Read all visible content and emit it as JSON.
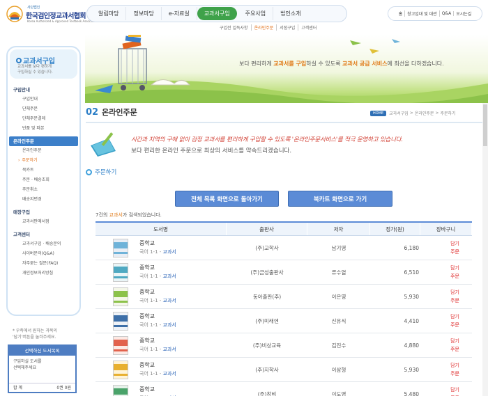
{
  "header": {
    "logo": {
      "small": "사단법인",
      "title": "한국검인정교과서협회",
      "eng": "Korea Authorized & Approved Textbook Association"
    },
    "gnb": [
      "알림마당",
      "정보마당",
      "e-자료실",
      "교과서구입",
      "주요사업",
      "법인소개"
    ],
    "gnb_active_index": 3,
    "subnav": [
      "구입전 일독사항",
      "온라인주문",
      "서점구입",
      "고객센터"
    ],
    "subnav_active_index": 1,
    "util": [
      "홈",
      "창고임대 및 대관",
      "Q&A",
      "오시는길"
    ]
  },
  "visual": {
    "text_pre": "보다 편리하게 ",
    "text_hl1": "교과서를 구입",
    "text_mid": "하실 수 있도록 ",
    "text_hl2": "교과서 공급 서비스",
    "text_post": "에 최선을 다하겠습니다."
  },
  "sidebar": {
    "title": "교과서구입",
    "desc1": "교과서를 보다 편하게",
    "desc2": "구입하실 수 있습니다.",
    "menu": [
      {
        "label": "구입안내",
        "level": 1,
        "active": false
      },
      {
        "label": "구입안내",
        "level": 2,
        "active": false
      },
      {
        "label": "단체주문",
        "level": 2,
        "active": false
      },
      {
        "label": "단체주문결제",
        "level": 2,
        "active": false
      },
      {
        "label": "반품 및 파본",
        "level": 2,
        "active": false
      },
      {
        "label": "온라인주문",
        "level": 1,
        "active": true
      },
      {
        "label": "온라인주문",
        "level": 2,
        "active": false
      },
      {
        "label": "주문하기",
        "level": 2,
        "active": true
      },
      {
        "label": "북카트",
        "level": 2,
        "active": false
      },
      {
        "label": "주문 · 배송조회",
        "level": 2,
        "active": false
      },
      {
        "label": "주문취소",
        "level": 2,
        "active": false
      },
      {
        "label": "배송지변경",
        "level": 2,
        "active": false
      },
      {
        "label": "매장구입",
        "level": 1,
        "active": false
      },
      {
        "label": "교과서판매서점",
        "level": 2,
        "active": false
      },
      {
        "label": "고객센터",
        "level": 1,
        "active": false
      },
      {
        "label": "교과서구입 · 배송문의",
        "level": 2,
        "active": false
      },
      {
        "label": "사이버문의(Q&A)",
        "level": 2,
        "active": false
      },
      {
        "label": "자주묻는 질문(FAQ)",
        "level": 2,
        "active": false
      },
      {
        "label": "개인정보처리방침",
        "level": 2,
        "active": false
      }
    ],
    "note1": "* 우측에서 원하는 과목의",
    "note2": "'담기'버튼을 눌러주세요.",
    "box": {
      "title": "선택하신 도서목록",
      "line1": "구입하실 도서를",
      "line2": "선택해주세요",
      "total_label": "합 계",
      "total_value": "0권 0원"
    }
  },
  "page": {
    "num": "02",
    "title": "온라인주문",
    "breadcrumb_home": "HOME",
    "breadcrumb": [
      "교과서구입",
      "온라인주문",
      "주문하기"
    ],
    "intro1": "시간과 지역의 구애 없이 검정 교과서를 편리하게 구입할 수 있도록 '온라인주문서비스'를 적극 운영하고 있습니다.",
    "intro2": "보다 편리한 온라인 주문으로 최상의 서비스를 약속드리겠습니다.",
    "section": "주문하기",
    "btn_back": "전체 목록 화면으로 돌아가기",
    "btn_cart": "북카트 화면으로 가기",
    "count_num": "7",
    "count_pre": "건의 ",
    "count_hl": "교과서",
    "count_post": "가 검색되었습니다.",
    "columns": [
      "도서명",
      "출판사",
      "저자",
      "정가(원)",
      "장바구니"
    ],
    "rows": [
      {
        "level": "중학교",
        "subject": "국어 1-1",
        "type": "교과서",
        "publisher": "(주)교학사",
        "author": "남기영",
        "price": "6,180",
        "act1": "담기",
        "act2": "주문",
        "cover": "#e9eef5",
        "band": "#6fb3d9"
      },
      {
        "level": "중학교",
        "subject": "국어 1-1",
        "type": "교과서",
        "publisher": "(주)금성출판사",
        "author": "류수열",
        "price": "6,510",
        "act1": "담기",
        "act2": "주문",
        "cover": "#eaf5f7",
        "band": "#4fa9c2"
      },
      {
        "level": "중학교",
        "subject": "국어 1-1",
        "type": "교과서",
        "publisher": "동아출판(주)",
        "author": "이은영",
        "price": "5,930",
        "act1": "담기",
        "act2": "주문",
        "cover": "#f4f7e8",
        "band": "#8cc24a"
      },
      {
        "level": "중학교",
        "subject": "국어 1-1",
        "type": "교과서",
        "publisher": "(주)미래엔",
        "author": "신유식",
        "price": "4,410",
        "act1": "담기",
        "act2": "주문",
        "cover": "#eef2f7",
        "band": "#3d6fa8"
      },
      {
        "level": "중학교",
        "subject": "국어 1-1",
        "type": "교과서",
        "publisher": "(주)비상교육",
        "author": "김진수",
        "price": "4,880",
        "act1": "담기",
        "act2": "주문",
        "cover": "#fde9e4",
        "band": "#e2624d"
      },
      {
        "level": "중학교",
        "subject": "국어 1-1",
        "type": "교과서",
        "publisher": "(주)지학사",
        "author": "이삼형",
        "price": "5,930",
        "act1": "담기",
        "act2": "주문",
        "cover": "#fff3d6",
        "band": "#e8b030"
      },
      {
        "level": "중학교",
        "subject": "국어 1-1",
        "type": "교과서",
        "publisher": "(주)창비",
        "author": "이도영",
        "price": "5,480",
        "act1": "담기",
        "act2": "주문",
        "cover": "#e6f2ea",
        "band": "#4aa36a"
      }
    ]
  }
}
